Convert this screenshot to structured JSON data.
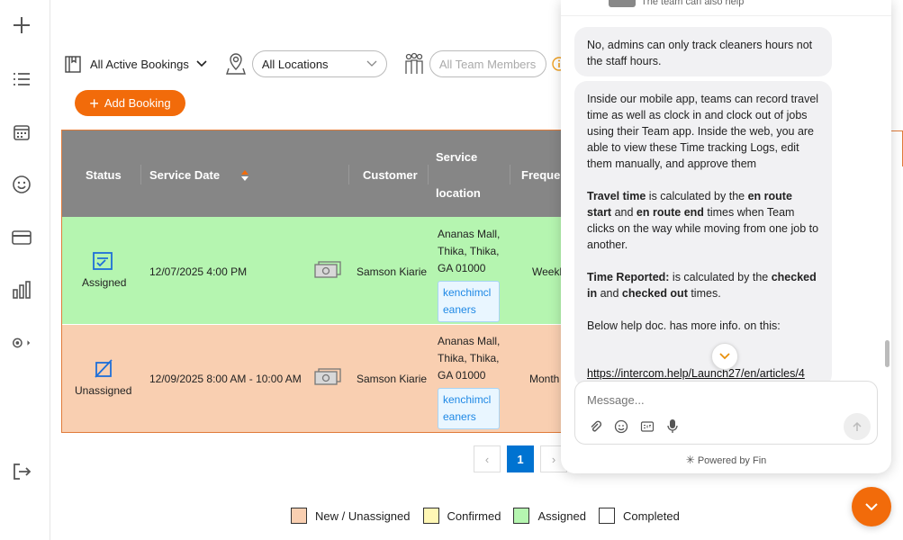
{
  "sidebar": {
    "items": [
      "add-icon",
      "list-icon",
      "calendar-icon",
      "smiley-icon",
      "card-icon",
      "chart-icon",
      "settings-icon",
      "logout-icon"
    ]
  },
  "filters": {
    "bookings": "All Active Bookings",
    "location": "All Locations",
    "team_placeholder": "All Team Members"
  },
  "toolbar": {
    "add_booking": "Add Booking"
  },
  "table": {
    "headers": {
      "status": "Status",
      "service_date": "Service Date",
      "customer": "Customer",
      "service_location_line1": "Service",
      "service_location_line2": "location",
      "frequency": "Frequen"
    },
    "rows": [
      {
        "status": "Assigned",
        "date": "12/07/2025 4:00 PM",
        "customer": "Samson Kiarie",
        "address_line1": "Ananas Mall,",
        "address_line2": "Thika, Thika,",
        "address_line3": "GA 01000",
        "chip_line1": "kenchimcl",
        "chip_line2": "eaners",
        "frequency": "Weekl"
      },
      {
        "status": "Unassigned",
        "date": "12/09/2025 8:00 AM - 10:00 AM",
        "customer": "Samson Kiarie",
        "address_line1": "Ananas Mall,",
        "address_line2": "Thika, Thika,",
        "address_line3": "GA 01000",
        "chip_line1": "kenchimcl",
        "chip_line2": "eaners",
        "frequency": "Month"
      }
    ]
  },
  "pagination": {
    "current": "1"
  },
  "legend": [
    {
      "label": "New / Unassigned",
      "color": "#f9cfb1"
    },
    {
      "label": "Confirmed",
      "color": "#fff7b5"
    },
    {
      "label": "Assigned",
      "color": "#b5f5b0"
    },
    {
      "label": "Completed",
      "color": "#ffffff"
    }
  ],
  "chat": {
    "top_hint": "The team can also help",
    "msg1": "No, admins can only track cleaners hours not the staff hours.",
    "msg2_p1": "Inside our mobile app, teams can record travel time as well as clock in and clock out of jobs using their Team app. Inside the web, you are able to view these Time tracking Logs, edit them manually, and approve them",
    "msg2_travel_bold": "Travel time",
    "msg2_travel_mid1": " is calculated by the ",
    "msg2_travel_bold2": "en route start",
    "msg2_travel_mid2": " and ",
    "msg2_travel_bold3": "en route end",
    "msg2_travel_end": " times when Team clicks on the way while moving from one job to another.",
    "msg2_time_bold": "Time Reported:",
    "msg2_time_mid": " is calculated by the ",
    "msg2_time_bold2": "checked in",
    "msg2_time_mid2": " and ",
    "msg2_time_bold3": "checked out",
    "msg2_time_end": " times.",
    "msg2_help": "Below help doc. has more info. on this:",
    "msg2_link": "https://intercom.help/Launch27/en/articles/4",
    "input_placeholder": "Message...",
    "powered_by": "Powered by Fin"
  },
  "colors": {
    "accent": "#f26b0a",
    "header": "#868686",
    "primary": "#0073d1"
  }
}
